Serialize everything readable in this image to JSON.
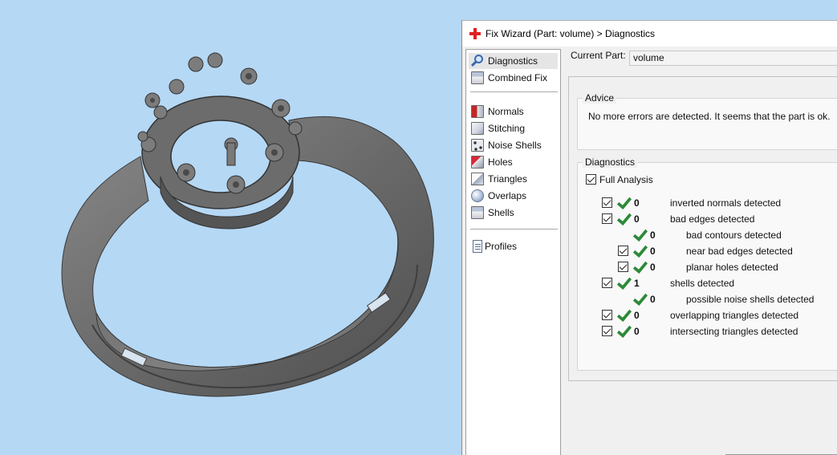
{
  "window": {
    "title": "Fix Wizard (Part: volume) > Diagnostics"
  },
  "nav": {
    "items": [
      {
        "label": "Diagnostics",
        "icon": "magnifier-icon",
        "selected": true
      },
      {
        "label": "Combined Fix",
        "icon": "combined-fix-icon"
      },
      {
        "label": "Normals",
        "icon": "normals-icon"
      },
      {
        "label": "Stitching",
        "icon": "stitching-icon"
      },
      {
        "label": "Noise Shells",
        "icon": "noise-shells-icon"
      },
      {
        "label": "Holes",
        "icon": "holes-icon"
      },
      {
        "label": "Triangles",
        "icon": "triangles-icon"
      },
      {
        "label": "Overlaps",
        "icon": "overlaps-icon"
      },
      {
        "label": "Shells",
        "icon": "shells-icon"
      },
      {
        "label": "Profiles",
        "icon": "profiles-icon"
      }
    ]
  },
  "current_part": {
    "label": "Current Part:",
    "value": "volume"
  },
  "advice": {
    "title": "Advice",
    "text": "No more errors are detected. It seems that the part is ok."
  },
  "diagnostics": {
    "title": "Diagnostics",
    "full_analysis_label": "Full Analysis",
    "full_analysis_checked": true,
    "rows": [
      {
        "checked": true,
        "ok": true,
        "count": "0",
        "label": "inverted normals detected",
        "indent": 0
      },
      {
        "checked": true,
        "ok": true,
        "count": "0",
        "label": "bad edges detected",
        "indent": 0
      },
      {
        "checked": null,
        "ok": true,
        "count": "0",
        "label": "bad contours detected",
        "indent": 1
      },
      {
        "checked": true,
        "ok": true,
        "count": "0",
        "label": "near bad edges detected",
        "indent": 1
      },
      {
        "checked": true,
        "ok": true,
        "count": "0",
        "label": "planar holes detected",
        "indent": 1
      },
      {
        "checked": true,
        "ok": true,
        "count": "1",
        "label": "shells detected",
        "indent": 0
      },
      {
        "checked": null,
        "ok": true,
        "count": "0",
        "label": "possible noise shells detected",
        "indent": 1
      },
      {
        "checked": true,
        "ok": true,
        "count": "0",
        "label": "overlapping triangles detected",
        "indent": 0
      },
      {
        "checked": true,
        "ok": true,
        "count": "0",
        "label": "intersecting triangles detected",
        "indent": 0
      }
    ]
  },
  "colors": {
    "viewport_bg": "#b5d8f5",
    "ok_green": "#2e8a3a",
    "model_gray": "#6e6e6e"
  }
}
